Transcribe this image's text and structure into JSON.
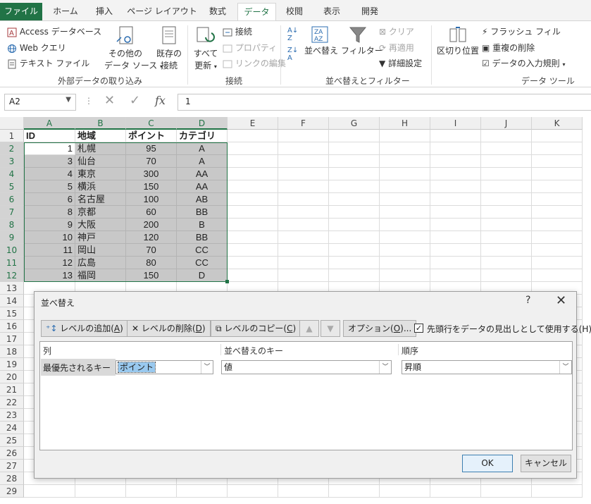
{
  "tabs": {
    "file": "ファイル",
    "home": "ホーム",
    "insert": "挿入",
    "page_layout": "ページ レイアウト",
    "formulas": "数式",
    "data": "データ",
    "review": "校閲",
    "view": "表示",
    "developer": "開発"
  },
  "ribbon": {
    "access": "Access データベース",
    "web_query": "Web クエリ",
    "text_file": "テキスト ファイル",
    "other_sources_1": "その他の",
    "other_sources_2": "データ ソース",
    "existing_1": "既存の",
    "existing_2": "接続",
    "refresh_1": "すべて",
    "refresh_2": "更新",
    "connections": "接続",
    "properties": "プロパティ",
    "edit_links": "リンクの編集",
    "sort": "並べ替え",
    "filter": "フィルター",
    "clear": "クリア",
    "reapply": "再適用",
    "advanced": "詳細設定",
    "text_to_columns": "区切り位置",
    "flash_fill": "フラッシュ フィル",
    "remove_duplicates": "重複の削除",
    "data_validation": "データの入力規則",
    "group_external": "外部データの取り込み",
    "group_connections": "接続",
    "group_sort_filter": "並べ替えとフィルター",
    "group_data_tools": "データ ツール"
  },
  "formula_bar": {
    "name_box": "A2",
    "formula": "1",
    "fx": "fx"
  },
  "sheet": {
    "columns": [
      "A",
      "B",
      "C",
      "D",
      "E",
      "F",
      "G",
      "H",
      "I",
      "J",
      "K"
    ],
    "rows": [
      "1",
      "2",
      "3",
      "4",
      "5",
      "6",
      "7",
      "8",
      "9",
      "10",
      "11",
      "12",
      "13",
      "14",
      "15",
      "16",
      "17",
      "18",
      "19",
      "20",
      "21",
      "22",
      "23",
      "24",
      "25",
      "26",
      "27",
      "28",
      "29"
    ],
    "header": [
      "ID",
      "地域",
      "ポイント",
      "カテゴリ"
    ],
    "data": [
      [
        "1",
        "札幌",
        "95",
        "A"
      ],
      [
        "3",
        "仙台",
        "70",
        "A"
      ],
      [
        "4",
        "東京",
        "300",
        "AA"
      ],
      [
        "5",
        "横浜",
        "150",
        "AA"
      ],
      [
        "6",
        "名古屋",
        "100",
        "AB"
      ],
      [
        "8",
        "京都",
        "60",
        "BB"
      ],
      [
        "9",
        "大阪",
        "200",
        "B"
      ],
      [
        "10",
        "神戸",
        "120",
        "BB"
      ],
      [
        "11",
        "岡山",
        "70",
        "CC"
      ],
      [
        "12",
        "広島",
        "80",
        "CC"
      ],
      [
        "13",
        "福岡",
        "150",
        "D"
      ]
    ]
  },
  "dialog": {
    "title": "並べ替え",
    "help": "?",
    "close": "✕",
    "add_level": "レベルの追加(",
    "add_level_key": "A",
    "delete_level": "レベルの削除(",
    "delete_level_key": "D",
    "copy_level": "レベルのコピー(",
    "copy_level_key": "C",
    "options": "オプション(",
    "options_key": "O",
    "has_headers": "先頭行をデータの見出しとして使用する(",
    "has_headers_key": "H",
    "col_header": "列",
    "sort_on_header": "並べ替えのキー",
    "order_header": "順序",
    "priority_label": "最優先されるキー",
    "column_value": "ポイント",
    "sort_on_value": "値",
    "order_value": "昇順",
    "ok": "OK",
    "cancel": "キャンセル"
  },
  "colors": {
    "excel_green": "#217346",
    "selection_shade": "#c8c8c8"
  }
}
